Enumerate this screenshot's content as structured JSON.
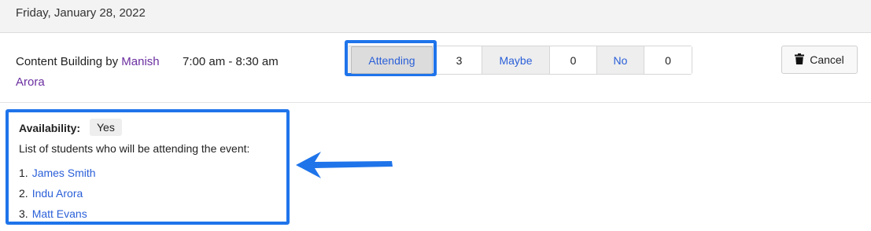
{
  "date": "Friday, January 28, 2022",
  "event": {
    "title_prefix": "Content Building by ",
    "organizer": "Manish Arora",
    "time": "7:00 am - 8:30 am"
  },
  "rsvp": {
    "attending_label": "Attending",
    "attending_count": "3",
    "maybe_label": "Maybe",
    "maybe_count": "0",
    "no_label": "No",
    "no_count": "0"
  },
  "cancel_label": "Cancel",
  "availability": {
    "label": "Availability:",
    "value": "Yes"
  },
  "attendees_heading": "List of students who will be attending the event:",
  "students": [
    {
      "num": "1.",
      "name": "James Smith"
    },
    {
      "num": "2.",
      "name": "Indu Arora"
    },
    {
      "num": "3.",
      "name": "Matt Evans"
    }
  ],
  "colors": {
    "highlight": "#1f74ea",
    "link": "#2a5fd8",
    "organizer": "#6b2fa0"
  },
  "icons": {
    "cancel": "trash-icon",
    "annotation": "arrow-left-icon"
  }
}
